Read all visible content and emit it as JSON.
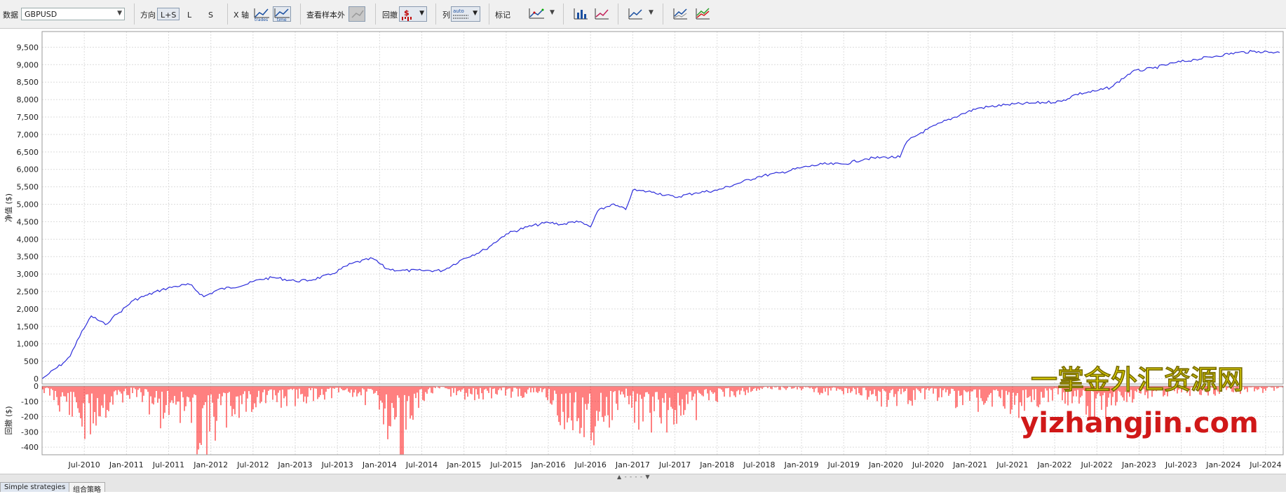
{
  "toolbar": {
    "data_label": "数据",
    "symbol": "GBPUSD",
    "direction_label": "方向",
    "dir_options": [
      "L+S",
      "L",
      "S"
    ],
    "xaxis_label": "X 轴",
    "xaxis_trades_caption": "trades",
    "xaxis_time_caption": "time",
    "oos_label": "查看样本外",
    "drawdown_label": "回撤",
    "drawdown_symbol": "$",
    "series_label": "列",
    "series_icon_caption": "auto",
    "markers_label": "标记"
  },
  "chart_data": [
    {
      "type": "line",
      "title": "",
      "ylabel": "净值 ($)",
      "xlabel": "",
      "ylim": [
        -150,
        9950
      ],
      "yticks": [
        0,
        500,
        1000,
        1500,
        2000,
        2500,
        3000,
        3500,
        4000,
        4500,
        5000,
        5500,
        6000,
        6500,
        7000,
        7500,
        8000,
        8500,
        9000,
        9500
      ],
      "ytick_labels": [
        "0",
        "500",
        "1,000",
        "1,500",
        "2,000",
        "2,500",
        "3,000",
        "3,500",
        "4,000",
        "4,500",
        "5,000",
        "5,500",
        "6,000",
        "6,500",
        "7,000",
        "7,500",
        "8,000",
        "8,500",
        "9,000",
        "9,500"
      ],
      "grid": true,
      "color": "#2d2ddb",
      "series": [
        {
          "x": [
            "2010-01",
            "2010-02",
            "2010-04",
            "2010-05",
            "2010-06",
            "2010-07",
            "2010-08",
            "2010-10",
            "2010-11",
            "2010-12",
            "2011-02",
            "2011-04",
            "2011-06",
            "2011-08",
            "2011-10",
            "2011-12",
            "2012-02",
            "2012-06",
            "2012-08",
            "2012-10",
            "2013-01",
            "2013-03",
            "2013-06",
            "2013-09",
            "2013-12",
            "2014-02",
            "2014-04",
            "2014-07",
            "2014-10",
            "2015-01",
            "2015-04",
            "2015-07",
            "2015-10",
            "2016-01",
            "2016-03",
            "2016-05",
            "2016-07",
            "2016-08",
            "2016-10",
            "2016-12",
            "2017-01",
            "2017-04",
            "2017-07",
            "2017-10",
            "2018-01",
            "2018-04",
            "2018-07",
            "2018-10",
            "2019-01",
            "2019-04",
            "2019-07",
            "2019-10",
            "2020-01",
            "2020-03",
            "2020-04",
            "2020-06",
            "2020-09",
            "2020-12",
            "2021-02",
            "2021-06",
            "2021-10",
            "2022-02",
            "2022-04",
            "2022-07",
            "2022-09",
            "2022-12",
            "2023-03",
            "2023-06",
            "2023-09",
            "2023-12",
            "2024-03",
            "2024-06",
            "2024-09"
          ],
          "y": [
            0,
            150,
            450,
            650,
            1100,
            1450,
            1800,
            1550,
            1750,
            1900,
            2250,
            2400,
            2550,
            2650,
            2700,
            2350,
            2550,
            2700,
            2850,
            2900,
            2800,
            2820,
            2980,
            3300,
            3450,
            3150,
            3100,
            3100,
            3100,
            3450,
            3700,
            4150,
            4350,
            4480,
            4420,
            4520,
            4350,
            4800,
            5000,
            4850,
            5400,
            5350,
            5200,
            5330,
            5400,
            5600,
            5800,
            5900,
            6050,
            6150,
            6150,
            6300,
            6350,
            6350,
            6800,
            7050,
            7350,
            7600,
            7750,
            7850,
            7900,
            7950,
            8150,
            8250,
            8350,
            8800,
            8900,
            9050,
            9150,
            9250,
            9350,
            9380,
            9350
          ]
        }
      ]
    },
    {
      "type": "bar",
      "title": "",
      "ylabel": "回撤 ($)",
      "xlabel": "",
      "ylim": [
        -450,
        0
      ],
      "yticks": [
        0,
        -100,
        -200,
        -300,
        -400
      ],
      "ytick_labels": [
        "0",
        "-100",
        "-200",
        "-300",
        "-400"
      ],
      "grid": true,
      "color": "#ff0000",
      "drawdown_profile": {
        "x": [
          "2010-01",
          "2010-03",
          "2010-05",
          "2010-07",
          "2010-09",
          "2010-12",
          "2011-02",
          "2011-06",
          "2011-08",
          "2011-10",
          "2011-12",
          "2012-02",
          "2012-05",
          "2012-08",
          "2012-12",
          "2013-04",
          "2013-09",
          "2014-01",
          "2014-03",
          "2014-05",
          "2014-07",
          "2014-09",
          "2015-01",
          "2015-06",
          "2016-01",
          "2016-03",
          "2016-05",
          "2016-07",
          "2016-09",
          "2016-12",
          "2017-02",
          "2017-05",
          "2017-08",
          "2017-11",
          "2018-03",
          "2018-07",
          "2018-12",
          "2019-04",
          "2019-09",
          "2020-01",
          "2020-04",
          "2020-08",
          "2020-12",
          "2021-04",
          "2021-08",
          "2022-01",
          "2022-04",
          "2022-07",
          "2022-10",
          "2023-01",
          "2023-06",
          "2023-12",
          "2024-06",
          "2024-09"
        ],
        "y": [
          -30,
          -120,
          -220,
          -380,
          -250,
          -120,
          -60,
          -230,
          -170,
          -320,
          -430,
          -300,
          -200,
          -150,
          -120,
          -80,
          -60,
          -150,
          -410,
          -380,
          -120,
          -20,
          -100,
          -60,
          -80,
          -330,
          -260,
          -330,
          -260,
          -100,
          -280,
          -230,
          -310,
          -120,
          -70,
          -30,
          -20,
          -50,
          -60,
          -120,
          -110,
          -80,
          -140,
          -130,
          -170,
          -80,
          -120,
          -210,
          -130,
          -80,
          -60,
          -50,
          -40,
          -20
        ]
      }
    }
  ],
  "xaxis": {
    "ticks": [
      "Jul-2010",
      "Jan-2011",
      "Jul-2011",
      "Jan-2012",
      "Jul-2012",
      "Jan-2013",
      "Jul-2013",
      "Jan-2014",
      "Jul-2014",
      "Jan-2015",
      "Jul-2015",
      "Jan-2016",
      "Jul-2016",
      "Jan-2017",
      "Jul-2017",
      "Jan-2018",
      "Jul-2018",
      "Jan-2019",
      "Jul-2019",
      "Jan-2020",
      "Jul-2020",
      "Jan-2021",
      "Jul-2021",
      "Jan-2022",
      "Jul-2022",
      "Jan-2023",
      "Jul-2023",
      "Jan-2024",
      "Jul-2024"
    ],
    "range": [
      "2010-01",
      "2024-09"
    ]
  },
  "watermark": {
    "cn": "一掌金外汇资源网",
    "en": "yizhangjin.com",
    "cn_color": "#f2e600",
    "en_color": "#d01818"
  },
  "tabs": [
    "Simple strategies",
    "组合策略"
  ]
}
